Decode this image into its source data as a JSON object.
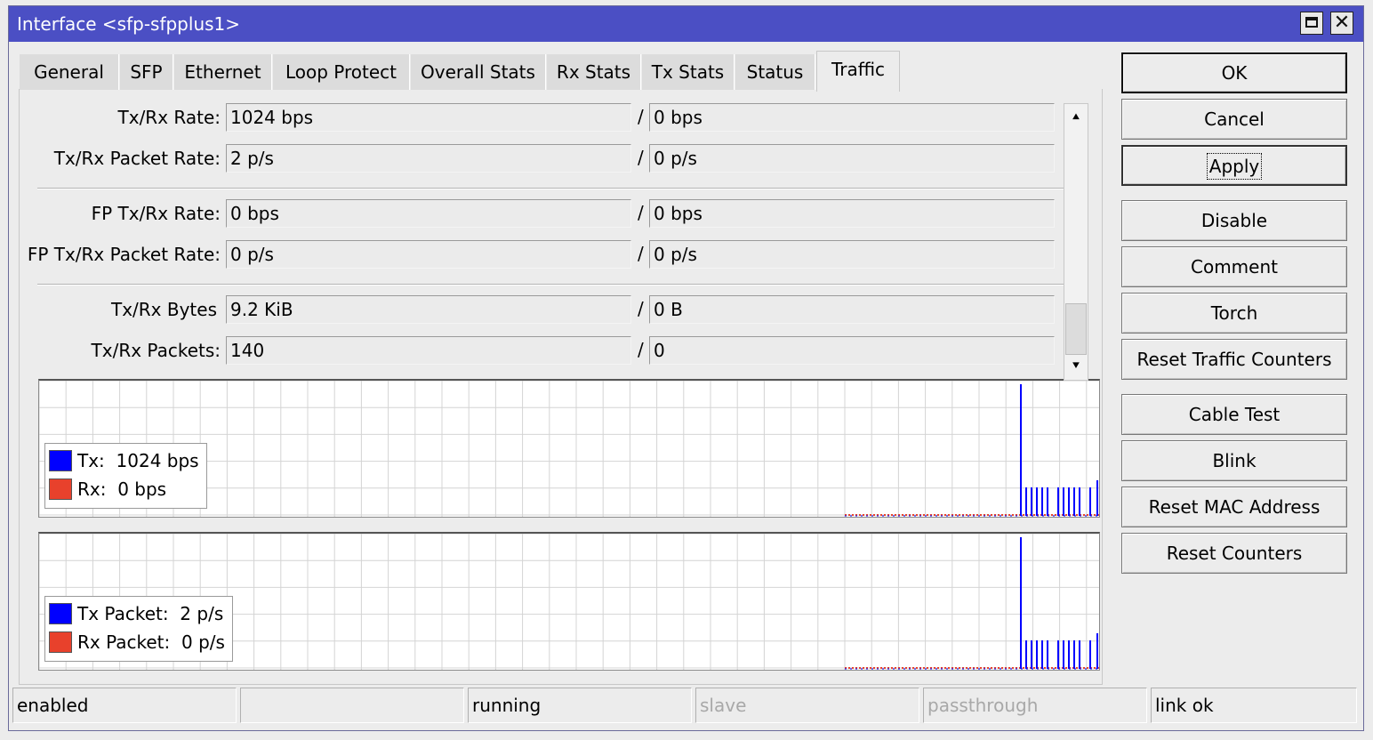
{
  "window": {
    "title": "Interface <sfp-sfpplus1>",
    "maximize_icon": "maximize-icon",
    "close_icon": "close-icon",
    "close_glyph": "✕"
  },
  "tabs": [
    {
      "label": "General",
      "active": false
    },
    {
      "label": "SFP",
      "active": false
    },
    {
      "label": "Ethernet",
      "active": false
    },
    {
      "label": "Loop Protect",
      "active": false
    },
    {
      "label": "Overall Stats",
      "active": false
    },
    {
      "label": "Rx Stats",
      "active": false
    },
    {
      "label": "Tx Stats",
      "active": false
    },
    {
      "label": "Status",
      "active": false
    },
    {
      "label": "Traffic",
      "active": true
    }
  ],
  "traffic": {
    "tx_rx_rate": {
      "label": "Tx/Rx Rate:",
      "tx": "1024 bps",
      "rx": "0 bps"
    },
    "tx_rx_packet_rate": {
      "label": "Tx/Rx Packet Rate:",
      "tx": "2 p/s",
      "rx": "0 p/s"
    },
    "fp_tx_rx_rate": {
      "label": "FP Tx/Rx Rate:",
      "tx": "0 bps",
      "rx": "0 bps"
    },
    "fp_tx_rx_packet_rate": {
      "label": "FP Tx/Rx Packet Rate:",
      "tx": "0 p/s",
      "rx": "0 p/s"
    },
    "tx_rx_bytes": {
      "label": "Tx/Rx Bytes",
      "tx": "9.2 KiB",
      "rx": "0 B"
    },
    "tx_rx_packets": {
      "label": "Tx/Rx Packets:",
      "tx": "140",
      "rx": "0"
    },
    "separator": "/"
  },
  "scroll": {
    "up_glyph": "⯅",
    "down_glyph": "⯆"
  },
  "graph_rate": {
    "legend": [
      {
        "prefix": "Tx:",
        "value": "1024 bps",
        "color": "#0000ff"
      },
      {
        "prefix": "Rx:",
        "value": "0 bps",
        "color": "#e8412c"
      }
    ]
  },
  "graph_packets": {
    "legend": [
      {
        "prefix": "Tx Packet:",
        "value": "2 p/s",
        "color": "#0000ff"
      },
      {
        "prefix": "Rx Packet:",
        "value": "0 p/s",
        "color": "#e8412c"
      }
    ]
  },
  "buttons": {
    "ok": "OK",
    "cancel": "Cancel",
    "apply": "Apply",
    "disable": "Disable",
    "comment": "Comment",
    "torch": "Torch",
    "reset_traffic_counters": "Reset Traffic Counters",
    "cable_test": "Cable Test",
    "blink": "Blink",
    "reset_mac_address": "Reset MAC Address",
    "reset_counters": "Reset Counters"
  },
  "status_bar": [
    "enabled",
    "",
    "running",
    "slave",
    "passthrough",
    "link ok"
  ]
}
